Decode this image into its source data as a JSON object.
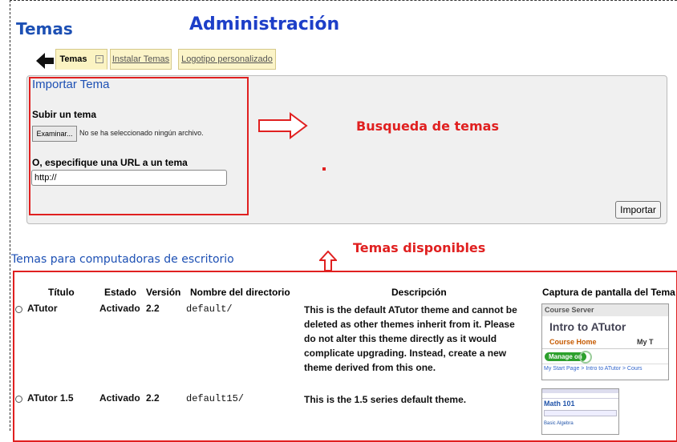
{
  "page": {
    "title": "Temas",
    "admin_title": "Administración"
  },
  "tabs": [
    {
      "label": "Temas"
    },
    {
      "label": "Instalar Temas"
    },
    {
      "label": "Logotipo personalizado"
    }
  ],
  "import_section": {
    "heading": "Importar Tema",
    "upload_label": "Subir un tema",
    "browse_button": "Examinar...",
    "no_file_text": "No se ha seleccionado ningún archivo.",
    "url_label": "O, especifique una URL a un tema",
    "url_value": "http://",
    "import_button": "Importar"
  },
  "annotations": {
    "busqueda": "Busqueda de temas",
    "disponibles": "Temas disponibles"
  },
  "colors": {
    "annotation_red": "#e02020",
    "heading_blue": "#1d50b4",
    "panel_bg": "#f0f0f0"
  },
  "desktop_themes": {
    "heading": "Temas para computadoras de escritorio",
    "columns": [
      "Título",
      "Estado",
      "Versión",
      "Nombre del directorio",
      "Descripción",
      "Captura de pantalla del Tema"
    ],
    "rows": [
      {
        "title": "ATutor",
        "status": "Activado",
        "version": "2.2",
        "directory": "default/",
        "description_lines": [
          "This is the default ATutor theme and cannot be",
          "deleted as other themes inherit from it. Please",
          "do not alter this theme directly as it would",
          "complicate upgrading. Instead, create a new",
          "theme derived from this one."
        ],
        "screenshot": {
          "server": "Course Server",
          "course": "Intro to ATutor",
          "tab_active": "Course Home",
          "tab_other": "My T",
          "manage": "Manage on",
          "breadcrumb": "My Start Page > Intro to ATutor > Cours"
        }
      },
      {
        "title": "ATutor 1.5",
        "status": "Activado",
        "version": "2.2",
        "directory": "default15/",
        "description_lines": [
          "This is the 1.5 series default theme."
        ],
        "screenshot": {
          "course": "Math 101",
          "section": "Basic Algebra"
        }
      }
    ]
  }
}
